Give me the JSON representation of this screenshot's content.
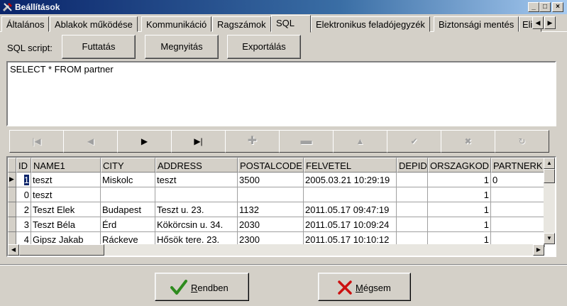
{
  "window": {
    "title": "Beállítások"
  },
  "caption_buttons": {
    "minimize": "_",
    "maximize": "□",
    "close": "×"
  },
  "tabs": [
    {
      "label": "Általános"
    },
    {
      "label": "Ablakok működése"
    },
    {
      "label": "Kommunikáció"
    },
    {
      "label": "Ragszámok"
    },
    {
      "label": "SQL"
    },
    {
      "label": "Elektronikus feladójegyzék"
    },
    {
      "label": "Biztonsági mentés"
    },
    {
      "label": "Eli"
    }
  ],
  "sql": {
    "label": "SQL script:",
    "run_label": "Futtatás",
    "open_label": "Megnyitás",
    "export_label": "Exportálás",
    "script": "SELECT * FROM partner"
  },
  "grid": {
    "columns": [
      "ID",
      "NAME1",
      "CITY",
      "ADDRESS",
      "POSTALCODE",
      "FELVETEL",
      "DEPID",
      "ORSZAGKOD",
      "PARTNERK"
    ],
    "rows": [
      [
        "1",
        "teszt",
        "Miskolc",
        "teszt",
        "3500",
        "2005.03.21 10:29:19",
        "",
        "1",
        "0"
      ],
      [
        "0",
        "teszt",
        "",
        "",
        "",
        "",
        "",
        "1",
        ""
      ],
      [
        "2",
        "Teszt Elek",
        "Budapest",
        "Teszt u. 23.",
        "1132",
        "2011.05.17 09:47:19",
        "",
        "1",
        ""
      ],
      [
        "3",
        "Teszt Béla",
        "Érd",
        "Kökörcsin u. 34.",
        "2030",
        "2011.05.17 10:09:24",
        "",
        "1",
        ""
      ],
      [
        "4",
        "Gipsz Jakab",
        "Ráckeve",
        "Hősök tere. 23.",
        "2300",
        "2011.05.17 10:10:12",
        "",
        "1",
        ""
      ]
    ]
  },
  "dialog": {
    "ok_accel": "R",
    "ok_rest": "endben",
    "cancel_accel": "M",
    "cancel_rest": "égsem"
  },
  "colors": {
    "titlebar": "#0a246a",
    "face": "#d4d0c8",
    "selection": "#0a246a",
    "ok_icon": "#2e8b1e",
    "cancel_icon": "#cc1010"
  }
}
